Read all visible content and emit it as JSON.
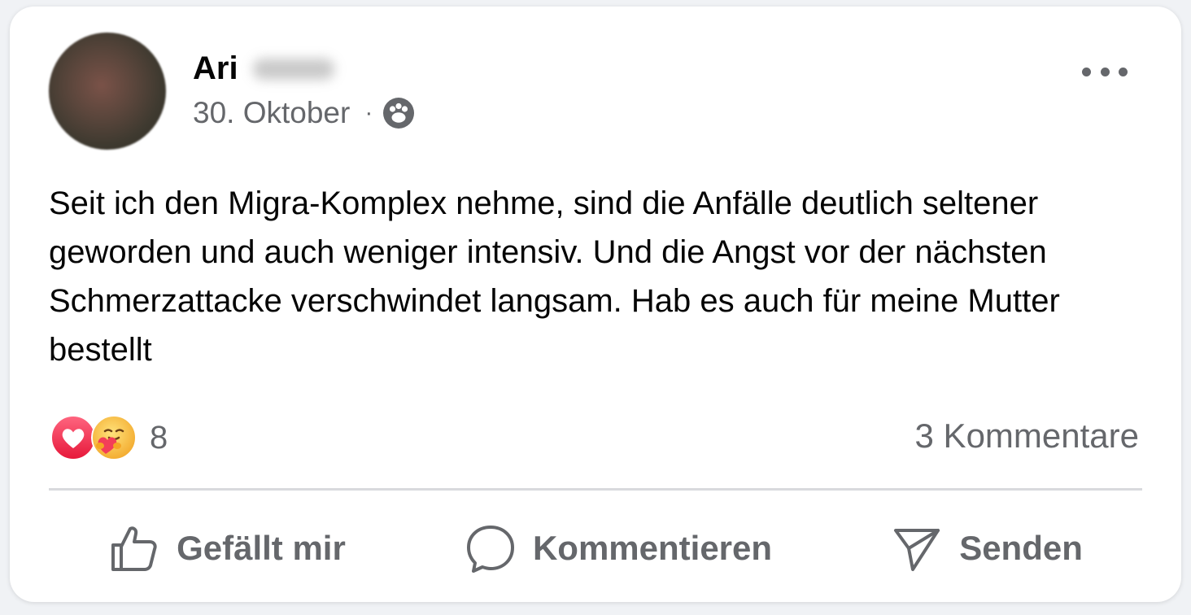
{
  "post": {
    "author_first_name": "Ari",
    "date": "30. Oktober",
    "separator": "·",
    "audience_icon": "friends-icon",
    "text": "Seit ich den Migra-Komplex nehme, sind die Anfälle deutlich seltener geworden und auch weniger intensiv. Und die Angst vor der nächsten Schmerzattacke verschwindet langsam. Hab es auch für meine Mutter bestellt"
  },
  "reactions": {
    "icons": [
      "love-reaction-icon",
      "care-reaction-icon"
    ],
    "count": "8"
  },
  "comments_count_label": "3 Kommentare",
  "actions": {
    "like": "Gefällt mir",
    "comment": "Kommentieren",
    "send": "Senden"
  },
  "colors": {
    "text_primary": "#050505",
    "text_secondary": "#65676b",
    "love": "#f33e58",
    "care": "#f7b125"
  }
}
